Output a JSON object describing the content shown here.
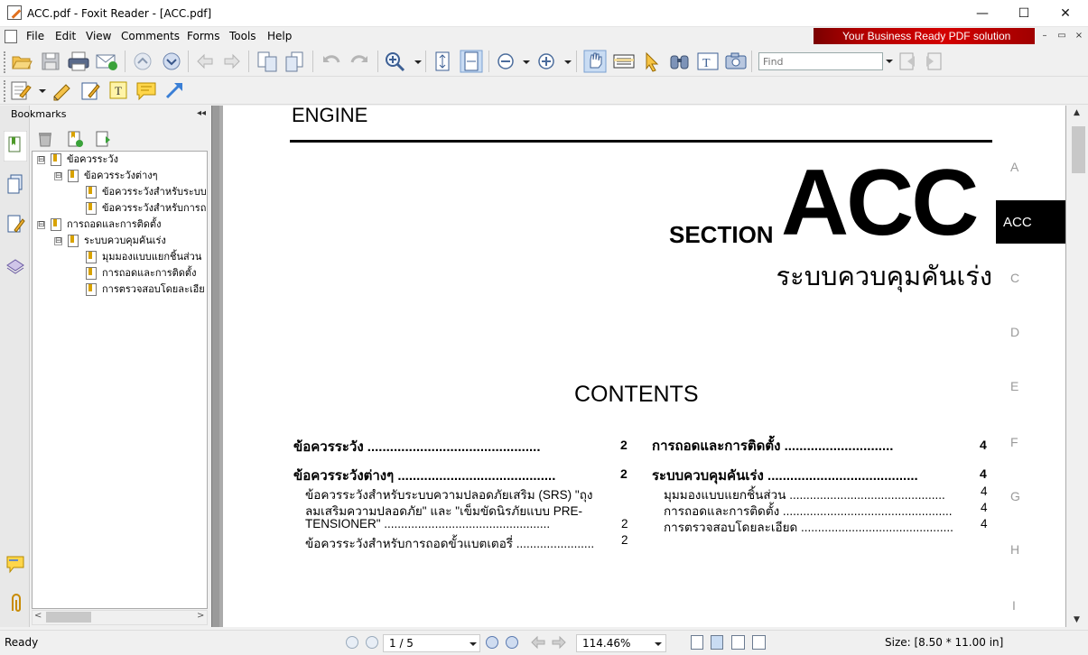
{
  "window": {
    "title": "ACC.pdf - Foxit Reader - [ACC.pdf]",
    "controls": {
      "minimize": "—",
      "maximize": "☐",
      "close": "✕"
    }
  },
  "menubar": {
    "items": [
      "File",
      "Edit",
      "View",
      "Comments",
      "Forms",
      "Tools",
      "Help"
    ],
    "banner": "Your Business Ready PDF solution",
    "mdi_controls": [
      "–",
      "▭",
      "×"
    ]
  },
  "toolbar": {
    "find_placeholder": "Find"
  },
  "bookmarks_panel": {
    "title": "Bookmarks",
    "collapse_glyph": "◂◂",
    "tree": [
      {
        "label": "ข้อควรระวัง",
        "expander": "⊟"
      },
      {
        "label": "ข้อควรระวังต่างๆ",
        "expander": "⊟"
      },
      {
        "label": "ข้อควรระวังสำหรับระบบ"
      },
      {
        "label": "ข้อควรระวังสำหรับการถ"
      },
      {
        "label": "การถอดและการติดตั้ง",
        "expander": "⊟"
      },
      {
        "label": "ระบบควบคุมคันเร่ง",
        "expander": "⊟"
      },
      {
        "label": "มุมมองแบบแยกชิ้นส่วน"
      },
      {
        "label": "การถอดและการติดตั้ง"
      },
      {
        "label": "การตรวจสอบโดยละเอีย"
      }
    ]
  },
  "document": {
    "header": "ENGINE",
    "section_word": "SECTION",
    "section_code": "ACC",
    "section_title": "ระบบควบคุมคันเร่ง",
    "contents_heading": "CONTENTS",
    "side_index": [
      "A",
      "ACC",
      "C",
      "D",
      "E",
      "F",
      "G",
      "H",
      "I"
    ],
    "toc_left": [
      {
        "text": "ข้อควรระวัง ..............................................",
        "page": "2",
        "bold": true
      },
      {
        "text": "ข้อควรระวังต่างๆ ..........................................",
        "page": "2",
        "bold": true
      },
      {
        "text": "ข้อควรระวังสำหรับระบบความปลอดภัยเสริม (SRS) \"ถุง",
        "page": "",
        "bold": false
      },
      {
        "text": "ลมเสริมความปลอดภัย\" และ \"เข็มขัดนิรภัยแบบ PRE-",
        "page": "",
        "bold": false
      },
      {
        "text": "TENSIONER\" .................................................",
        "page": "2",
        "bold": false
      },
      {
        "text": "ข้อควรระวังสำหรับการถอดขั้วแบตเตอรี่ .......................",
        "page": "2",
        "bold": false
      }
    ],
    "toc_right": [
      {
        "text": "การถอดและการติดตั้ง .............................",
        "page": "4",
        "bold": true
      },
      {
        "text": "ระบบควบคุมคันเร่ง ........................................",
        "page": "4",
        "bold": true
      },
      {
        "text": "มุมมองแบบแยกชิ้นส่วน ..............................................",
        "page": "4",
        "bold": false
      },
      {
        "text": "การถอดและการติดตั้ง ..................................................",
        "page": "4",
        "bold": false
      },
      {
        "text": "การตรวจสอบโดยละเอียด .............................................",
        "page": "4",
        "bold": false
      }
    ]
  },
  "statusbar": {
    "status": "Ready",
    "page_indicator": "1 / 5",
    "zoom": "114.46%",
    "page_size": "Size: [8.50 * 11.00 in]"
  }
}
